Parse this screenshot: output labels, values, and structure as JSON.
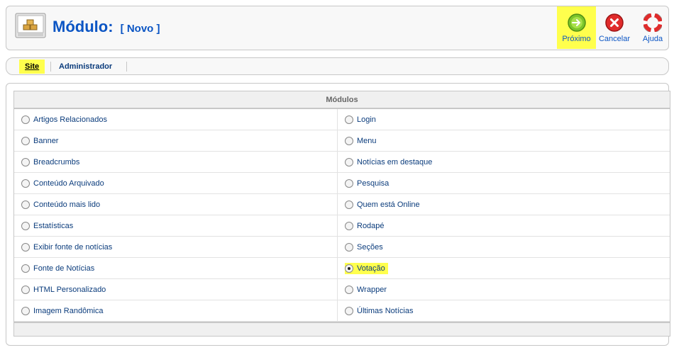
{
  "header": {
    "title": "Módulo:",
    "subtitle": "[ Novo ]",
    "icon": "module-icon"
  },
  "toolbar": {
    "next_label": "Próximo",
    "cancel_label": "Cancelar",
    "help_label": "Ajuda"
  },
  "submenu": {
    "site_label": "Site",
    "admin_label": "Administrador"
  },
  "modules": {
    "header": "Módulos",
    "left": [
      "Artigos Relacionados",
      "Banner",
      "Breadcrumbs",
      "Conteúdo Arquivado",
      "Conteúdo mais lido",
      "Estatísticas",
      "Exibir fonte de notícias",
      "Fonte de Notícias",
      "HTML Personalizado",
      "Imagem Randômica"
    ],
    "right": [
      "Login",
      "Menu",
      "Notícias em destaque",
      "Pesquisa",
      "Quem está Online",
      "Rodapé",
      "Seções",
      "Votação",
      "Wrapper",
      "Últimas Notícias"
    ],
    "selected": "Votação"
  },
  "colors": {
    "highlight": "#ffff4d",
    "title_blue": "#0b55c4",
    "link_blue": "#0b3c7c"
  }
}
